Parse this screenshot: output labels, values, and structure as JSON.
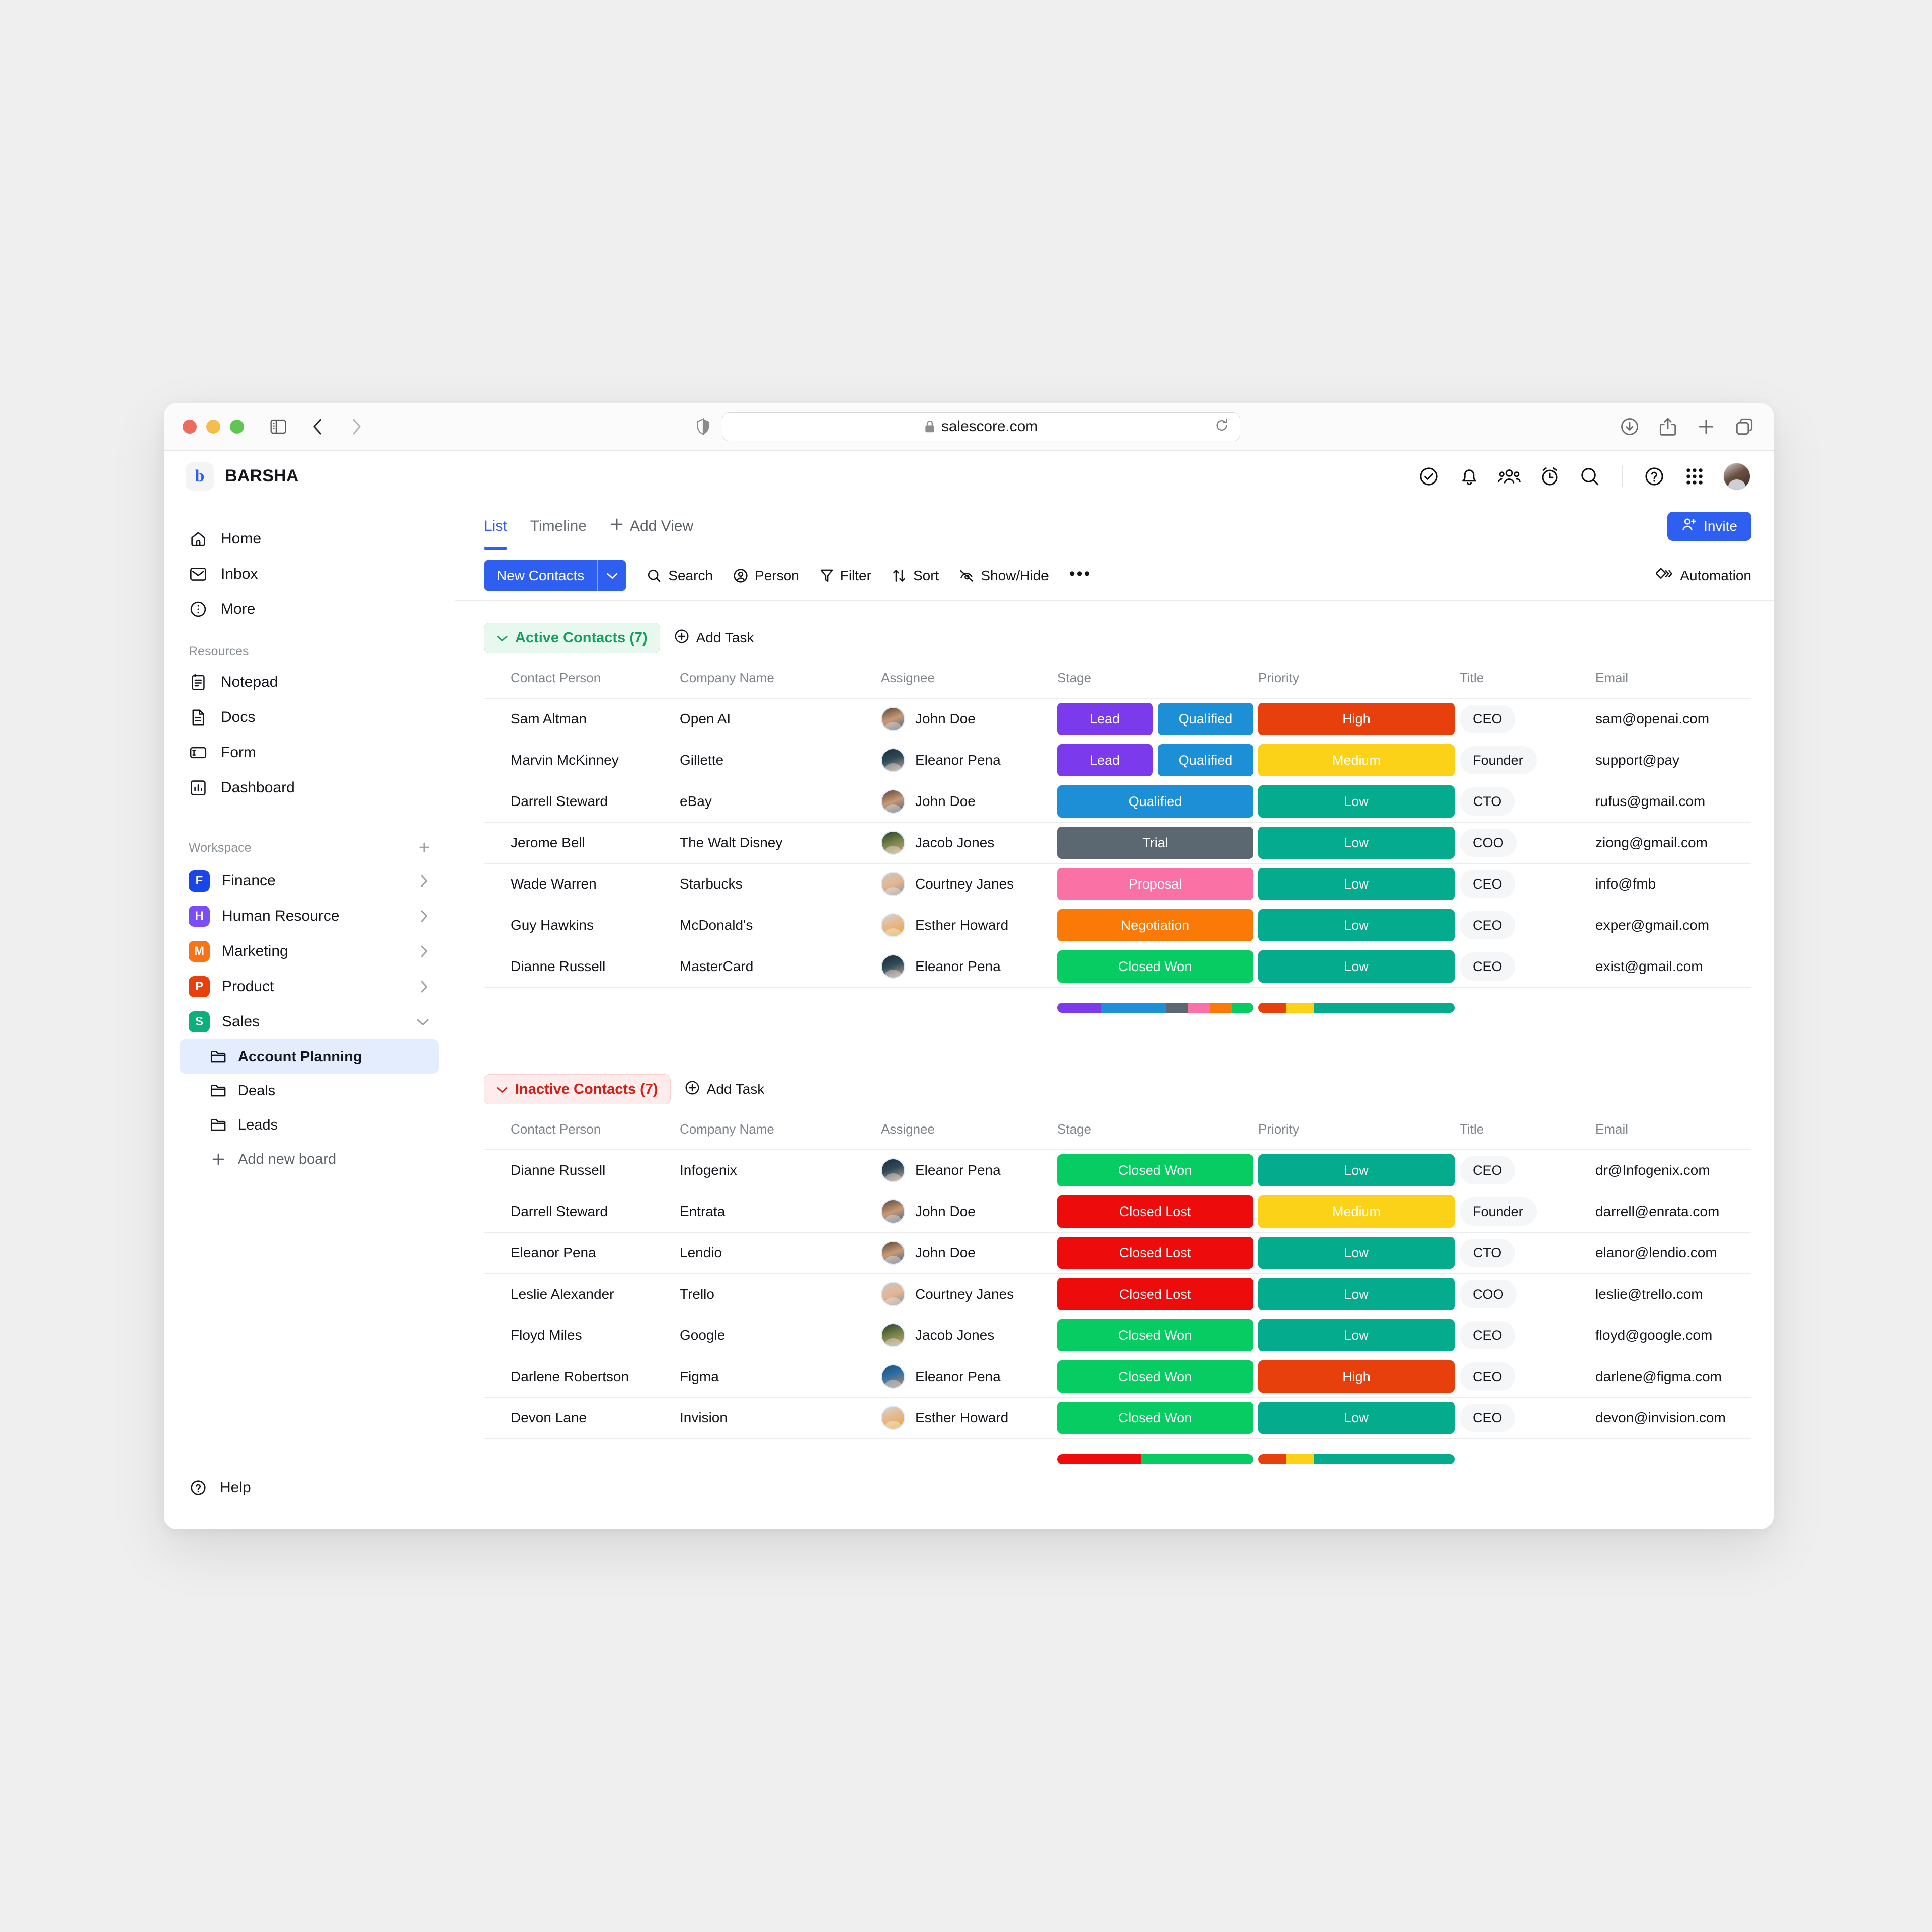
{
  "browser": {
    "url": "salescore.com",
    "icons": {
      "sidebar_toggle": "sidebar-toggle-icon",
      "back": "back-chevron-icon",
      "forward": "forward-chevron-icon",
      "shield": "shield-icon",
      "lock": "lock-icon",
      "reload": "reload-icon",
      "download": "download-icon",
      "share": "share-icon",
      "new_tab": "plus-icon",
      "tabs": "tab-overview-icon"
    }
  },
  "app_header": {
    "logo_letter": "b",
    "brand": "BARSHA",
    "icons": [
      "check-circle-icon",
      "bell-icon",
      "people-icon",
      "alarm-clock-icon",
      "search-icon",
      "help-circle-icon",
      "apps-grid-icon"
    ],
    "avatar": "user-avatar"
  },
  "sidebar": {
    "nav": [
      {
        "label": "Home",
        "icon": "home-icon"
      },
      {
        "label": "Inbox",
        "icon": "inbox-icon"
      },
      {
        "label": "More",
        "icon": "more-circle-icon"
      }
    ],
    "resources_label": "Resources",
    "resources": [
      {
        "label": "Notepad",
        "icon": "notepad-icon"
      },
      {
        "label": "Docs",
        "icon": "docs-icon"
      },
      {
        "label": "Form",
        "icon": "form-icon"
      },
      {
        "label": "Dashboard",
        "icon": "dashboard-icon"
      }
    ],
    "workspace_label": "Workspace",
    "workspace_add": "+",
    "workspaces": [
      {
        "label": "Finance",
        "initial": "F",
        "color": "#1a45e8",
        "expanded": false
      },
      {
        "label": "Human Resource",
        "initial": "H",
        "color": "#7b4df5",
        "expanded": false
      },
      {
        "label": "Marketing",
        "initial": "M",
        "color": "#f97316",
        "expanded": false
      },
      {
        "label": "Product",
        "initial": "P",
        "color": "#e8400c",
        "expanded": false
      },
      {
        "label": "Sales",
        "initial": "S",
        "color": "#0bb07b",
        "expanded": true
      }
    ],
    "boards": [
      {
        "label": "Account Planning",
        "active": true
      },
      {
        "label": "Deals",
        "active": false
      },
      {
        "label": "Leads",
        "active": false
      }
    ],
    "add_board": "Add new board",
    "help": "Help"
  },
  "views": {
    "tabs": [
      {
        "label": "List",
        "active": true
      },
      {
        "label": "Timeline",
        "active": false
      }
    ],
    "add_view": "Add View",
    "invite": "Invite"
  },
  "toolbar": {
    "selected_view": "New Contacts",
    "buttons": [
      {
        "label": "Search",
        "icon": "search-icon"
      },
      {
        "label": "Person",
        "icon": "person-icon"
      },
      {
        "label": "Filter",
        "icon": "filter-icon"
      },
      {
        "label": "Sort",
        "icon": "sort-icon"
      },
      {
        "label": "Show/Hide",
        "icon": "eye-off-icon"
      }
    ],
    "more": "•••",
    "automation": "Automation"
  },
  "columns": [
    "Contact Person",
    "Company Name",
    "Assignee",
    "Stage",
    "Priority",
    "Title",
    "Email"
  ],
  "stage_colors": {
    "Lead": "#7c3aed",
    "Qualified": "#1c8fd6",
    "Trial": "#5b6771",
    "Proposal": "#fa71a5",
    "Negotiation": "#fb7a07",
    "Closed Won": "#07cc62",
    "Closed Lost": "#ee0b0b"
  },
  "priority_colors": {
    "High": "#e8400c",
    "Medium": "#fbd217",
    "Low": "#04ab8c"
  },
  "groups": [
    {
      "name": "Active Contacts (7)",
      "tone": "green",
      "add_task": "Add Task",
      "rows": [
        {
          "contact": "Sam Altman",
          "company": "Open AI",
          "assignee": "John Doe",
          "avatar": "m1",
          "stages": [
            "Lead",
            "Qualified"
          ],
          "priority": "High",
          "title": "CEO",
          "email": "sam@openai.com"
        },
        {
          "contact": "Marvin McKinney",
          "company": "Gillette",
          "assignee": "Eleanor Pena",
          "avatar": "f1",
          "stages": [
            "Lead",
            "Qualified"
          ],
          "priority": "Medium",
          "title": "Founder",
          "email": "support@pay"
        },
        {
          "contact": "Darrell Steward",
          "company": "eBay",
          "assignee": "John Doe",
          "avatar": "m1",
          "stages": [
            "Qualified"
          ],
          "priority": "Low",
          "title": "CTO",
          "email": "rufus@gmail.com"
        },
        {
          "contact": "Jerome Bell",
          "company": "The Walt Disney",
          "assignee": "Jacob Jones",
          "avatar": "m2",
          "stages": [
            "Trial"
          ],
          "priority": "Low",
          "title": "COO",
          "email": "ziong@gmail.com"
        },
        {
          "contact": "Wade Warren",
          "company": "Starbucks",
          "assignee": "Courtney Janes",
          "avatar": "f2",
          "stages": [
            "Proposal"
          ],
          "priority": "Low",
          "title": "CEO",
          "email": "info@fmb"
        },
        {
          "contact": "Guy Hawkins",
          "company": "McDonald's",
          "assignee": "Esther Howard",
          "avatar": "f3",
          "stages": [
            "Negotiation"
          ],
          "priority": "Low",
          "title": "CEO",
          "email": "exper@gmail.com"
        },
        {
          "contact": "Dianne Russell",
          "company": "MasterCard",
          "assignee": "Eleanor Pena",
          "avatar": "f1",
          "stages": [
            "Closed Won"
          ],
          "priority": "Low",
          "title": "CEO",
          "email": "exist@gmail.com"
        }
      ],
      "stage_summary": [
        {
          "color": "#7c3aed",
          "weight": 2
        },
        {
          "color": "#1c8fd6",
          "weight": 3
        },
        {
          "color": "#5b6771",
          "weight": 1
        },
        {
          "color": "#fa71a5",
          "weight": 1
        },
        {
          "color": "#fb7a07",
          "weight": 1
        },
        {
          "color": "#07cc62",
          "weight": 1
        }
      ],
      "priority_summary": [
        {
          "color": "#e8400c",
          "weight": 1
        },
        {
          "color": "#fbd217",
          "weight": 1
        },
        {
          "color": "#04ab8c",
          "weight": 5
        }
      ]
    },
    {
      "name": "Inactive Contacts (7)",
      "tone": "red",
      "add_task": "Add Task",
      "rows": [
        {
          "contact": "Dianne Russell",
          "company": "Infogenix",
          "assignee": "Eleanor Pena",
          "avatar": "f1",
          "stages": [
            "Closed Won"
          ],
          "priority": "Low",
          "title": "CEO",
          "email": "dr@Infogenix.com"
        },
        {
          "contact": "Darrell Steward",
          "company": "Entrata",
          "assignee": "John Doe",
          "avatar": "m1",
          "stages": [
            "Closed Lost"
          ],
          "priority": "Medium",
          "title": "Founder",
          "email": "darrell@enrata.com"
        },
        {
          "contact": "Eleanor Pena",
          "company": "Lendio",
          "assignee": "John Doe",
          "avatar": "m1",
          "stages": [
            "Closed Lost"
          ],
          "priority": "Low",
          "title": "CTO",
          "email": "elanor@lendio.com"
        },
        {
          "contact": "Leslie Alexander",
          "company": "Trello",
          "assignee": "Courtney Janes",
          "avatar": "f2",
          "stages": [
            "Closed Lost"
          ],
          "priority": "Low",
          "title": "COO",
          "email": "leslie@trello.com"
        },
        {
          "contact": "Floyd Miles",
          "company": "Google",
          "assignee": "Jacob Jones",
          "avatar": "m2",
          "stages": [
            "Closed Won"
          ],
          "priority": "Low",
          "title": "CEO",
          "email": "floyd@google.com"
        },
        {
          "contact": "Darlene Robertson",
          "company": "Figma",
          "assignee": "Eleanor Pena",
          "avatar": "m3",
          "stages": [
            "Closed Won"
          ],
          "priority": "High",
          "title": "CEO",
          "email": "darlene@figma.com"
        },
        {
          "contact": "Devon Lane",
          "company": "Invision",
          "assignee": "Esther Howard",
          "avatar": "f3",
          "stages": [
            "Closed Won"
          ],
          "priority": "Low",
          "title": "CEO",
          "email": "devon@invision.com"
        }
      ],
      "stage_summary": [
        {
          "color": "#ee0b0b",
          "weight": 3
        },
        {
          "color": "#07cc62",
          "weight": 4
        }
      ],
      "priority_summary": [
        {
          "color": "#e8400c",
          "weight": 1
        },
        {
          "color": "#fbd217",
          "weight": 1
        },
        {
          "color": "#04ab8c",
          "weight": 5
        }
      ]
    }
  ]
}
